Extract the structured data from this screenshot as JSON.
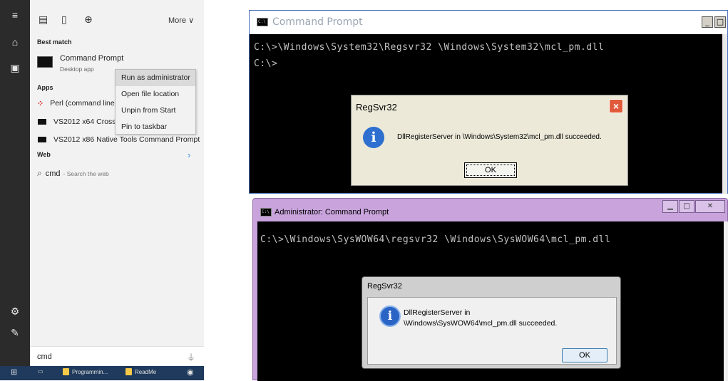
{
  "start_panel": {
    "top_bar": {
      "more_label": "More ∨"
    },
    "best_match": {
      "section_label": "Best match",
      "title": "Command Prompt",
      "subtitle": "Desktop app"
    },
    "context_menu": [
      "Run as administrator",
      "Open file location",
      "Unpin from Start",
      "Pin to taskbar"
    ],
    "apps": {
      "section_label": "Apps",
      "items": [
        "Perl (command line",
        "VS2012 x64 Cross T",
        "VS2012 x86 Native Tools Command Prompt"
      ]
    },
    "web": {
      "section_label": "Web",
      "query": "cmd",
      "query_suffix": "- Search the web"
    },
    "search_box": {
      "value": "cmd"
    },
    "taskbar": {
      "items": [
        "Programmin...",
        "ReadMe"
      ]
    }
  },
  "cmd_window_1": {
    "title": "Command Prompt",
    "lines": [
      "C:\\>\\Windows\\System32\\Regsvr32 \\Windows\\System32\\mcl_pm.dll",
      "C:\\>"
    ],
    "dialog": {
      "title": "RegSvr32",
      "message": "DllRegisterServer in \\Windows\\System32\\mcl_pm.dll succeeded.",
      "ok_label": "OK"
    }
  },
  "cmd_window_2": {
    "title": "Administrator: Command Prompt",
    "lines": [
      "C:\\>\\Windows\\SysWOW64\\regsvr32 \\Windows\\SysWOW64\\mcl_pm.dll"
    ],
    "dialog": {
      "title": "RegSvr32",
      "message_line1": "DllRegisterServer in",
      "message_line2": "\\Windows\\SysWOW64\\mcl_pm.dll succeeded.",
      "ok_label": "OK"
    }
  },
  "colors": {
    "start_rail": "#2b2b2b",
    "start_panel": "#f2f2f2",
    "console_bg": "#000000",
    "console_text": "#c0c0c0",
    "aero_frame": "#c8a3dc",
    "taskbar": "#1f3a5c"
  }
}
